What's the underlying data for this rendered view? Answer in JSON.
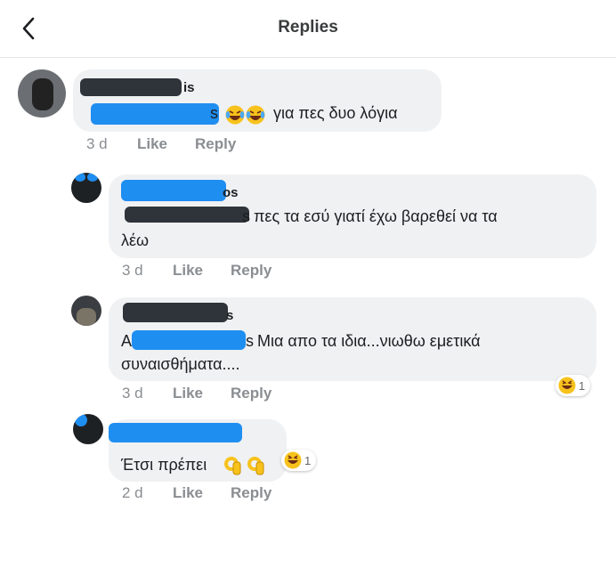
{
  "header": {
    "title": "Replies"
  },
  "comments": [
    {
      "name_tail": "is",
      "text_prefix": "",
      "text_tail": "s",
      "text": "για πες δυο λόγια",
      "time": "3 d",
      "like": "Like",
      "reply": "Reply"
    },
    {
      "name_tail": "os",
      "text_tail": "s",
      "text_line1": "πες τα εσύ γιατί έχω βαρεθεί να τα",
      "text_line2": "λέω",
      "time": "3 d",
      "like": "Like",
      "reply": "Reply"
    },
    {
      "name_tail": "s",
      "text_prefix": "A",
      "text_tail": "s",
      "text_line1": "Μια απο τα ιδια...νιωθω εμετικά",
      "text_line2": "συναισθήματα....",
      "time": "3 d",
      "like": "Like",
      "reply": "Reply",
      "reaction_count": "1"
    },
    {
      "text": "Έτσι πρέπει",
      "time": "2 d",
      "like": "Like",
      "reply": "Reply",
      "reaction_count": "1"
    }
  ],
  "icons": {
    "back": "chevron-left-icon",
    "laugh": "laughing-tears-emoji",
    "haha": "haha-reaction-icon",
    "ok": "ok-hand-emoji"
  },
  "colors": {
    "bubble": "#f0f1f3",
    "meta": "#8a8d91",
    "redact_blue": "#1f8ef1",
    "redact_dark": "#2f343a"
  }
}
